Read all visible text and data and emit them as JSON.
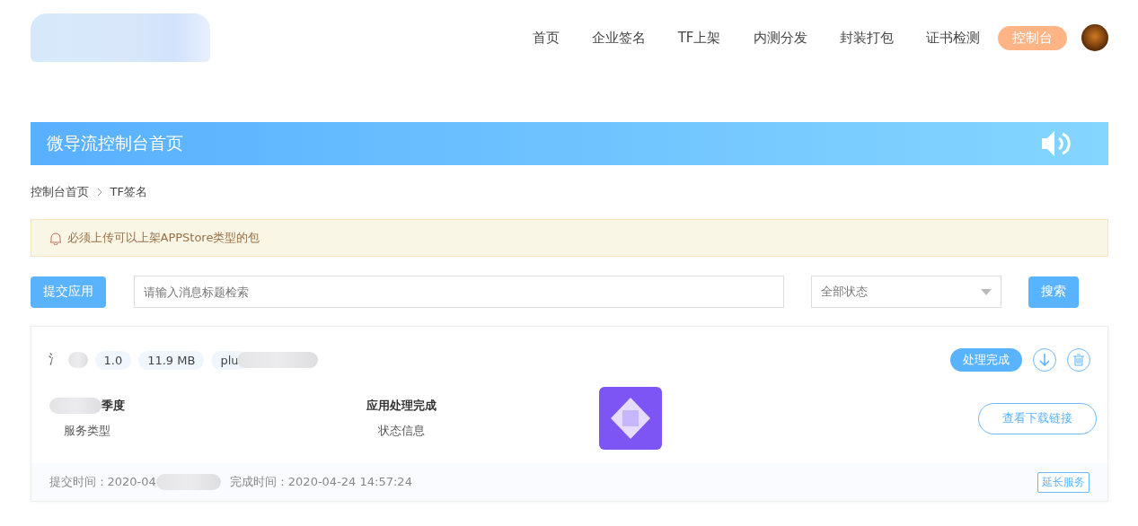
{
  "nav": {
    "items": [
      {
        "label": "首页",
        "selected": false
      },
      {
        "label": "企业签名",
        "selected": false
      },
      {
        "label": "TF上架",
        "selected": false
      },
      {
        "label": "内测分发",
        "selected": false
      },
      {
        "label": "封装打包",
        "selected": false
      },
      {
        "label": "证书检测",
        "selected": false
      },
      {
        "label": "控制台",
        "selected": true
      }
    ]
  },
  "banner": {
    "title": "微导流控制台首页"
  },
  "breadcrumb": [
    "控制台首页",
    "TF签名"
  ],
  "notice": "必须上传可以上架APPStore类型的包",
  "toolbar": {
    "submit": "提交应用",
    "search": {
      "placeholder": "请输入消息标题检索"
    },
    "status_select": "全部状态",
    "search_button": "搜索"
  },
  "app_card": {
    "name": "氵",
    "tags": [
      "1.0",
      "11.9 MB",
      "plu"
    ],
    "status": "处理完成",
    "info": [
      {
        "value": "季度",
        "label": "服务类型",
        "blurred": true
      },
      {
        "value": "应用处理完成",
        "label": "状态信息",
        "blurred": false
      }
    ],
    "link_button": "查看下载链接",
    "submit_time": {
      "label": "提交时间：",
      "value": "2020-04"
    },
    "finish_time": {
      "label": "完成时间：",
      "value": "2020-04-24 14:57:24"
    },
    "extend_button": "延长服务"
  }
}
